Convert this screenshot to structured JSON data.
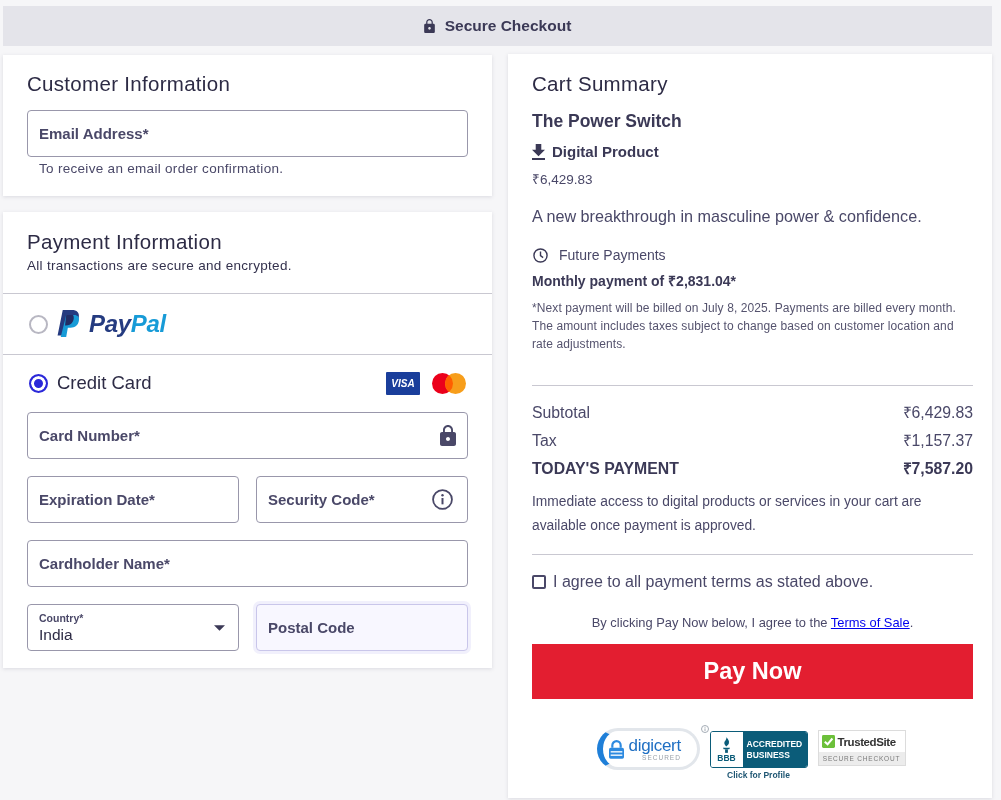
{
  "header": {
    "title": "Secure Checkout"
  },
  "customer_information": {
    "title": "Customer Information",
    "email_field": {
      "kind": "text",
      "placeholder": "Email Address*",
      "focused": false
    },
    "helper_text": "To receive an email order confirmation."
  },
  "payment_information": {
    "title": "Payment Information",
    "subtitle": "All transactions are secure and encrypted.",
    "methods": [
      {
        "kind": "paypal",
        "selected": false,
        "wordmark": [
          "Pay",
          "Pal"
        ]
      },
      {
        "kind": "card",
        "selected": true,
        "label": "Credit Card",
        "brands": [
          {
            "kind": "visa",
            "text": "VISA"
          },
          {
            "kind": "mastercard"
          }
        ]
      }
    ],
    "field_rows": [
      {
        "fields": [
          {
            "kind": "secure",
            "placeholder": "Card Number*",
            "focused": false
          }
        ]
      },
      {
        "fields": [
          {
            "kind": "text",
            "placeholder": "Expiration Date*",
            "focused": false
          },
          {
            "kind": "hint",
            "placeholder": "Security Code*",
            "focused": false
          }
        ]
      },
      {
        "fields": [
          {
            "kind": "text",
            "placeholder": "Cardholder Name*",
            "focused": false
          }
        ]
      },
      {
        "fields": [
          {
            "kind": "select",
            "label": "Country*",
            "value": "India",
            "focused": false
          },
          {
            "kind": "text",
            "placeholder": "Postal Code",
            "focused": true
          }
        ]
      }
    ]
  },
  "cart_summary": {
    "title": "Cart Summary",
    "product": {
      "name": "The Power Switch",
      "type_label": "Digital Product",
      "price": "₹6,429.83",
      "description": "A new breakthrough in masculine power & confidence."
    },
    "future_payments": {
      "heading": "Future Payments",
      "amount_line": "Monthly payment of ₹2,831.04*",
      "note": "*Next payment will be billed on July 8, 2025. Payments are billed every month. The amount includes taxes subject to change based on customer location and rate adjustments."
    },
    "totals": [
      {
        "kind": "line",
        "label": "Subtotal",
        "value": "₹6,429.83"
      },
      {
        "kind": "line",
        "label": "Tax",
        "value": "₹1,157.37"
      },
      {
        "kind": "total",
        "label": "TODAY'S PAYMENT",
        "value": "₹7,587.20"
      }
    ],
    "access_note": "Immediate access to digital products or services in your cart are available once payment is approved.",
    "agree": {
      "label": "I agree to all payment terms as stated above.",
      "checked": false
    },
    "terms_note": {
      "text": "By clicking Pay Now below, I agree to the",
      "link": "Terms of Sale",
      "end": "."
    },
    "pay_button": "Pay Now",
    "trust_badges": [
      {
        "kind": "digicert",
        "name": "digicert",
        "caption": "SECURED"
      },
      {
        "kind": "bbb",
        "mark": "BBB",
        "text": "ACCREDITED BUSINESS",
        "caption": "Click for Profile"
      },
      {
        "kind": "trustedsite",
        "name": "TrustedSite",
        "caption": "SECURE CHECKOUT"
      }
    ]
  }
}
